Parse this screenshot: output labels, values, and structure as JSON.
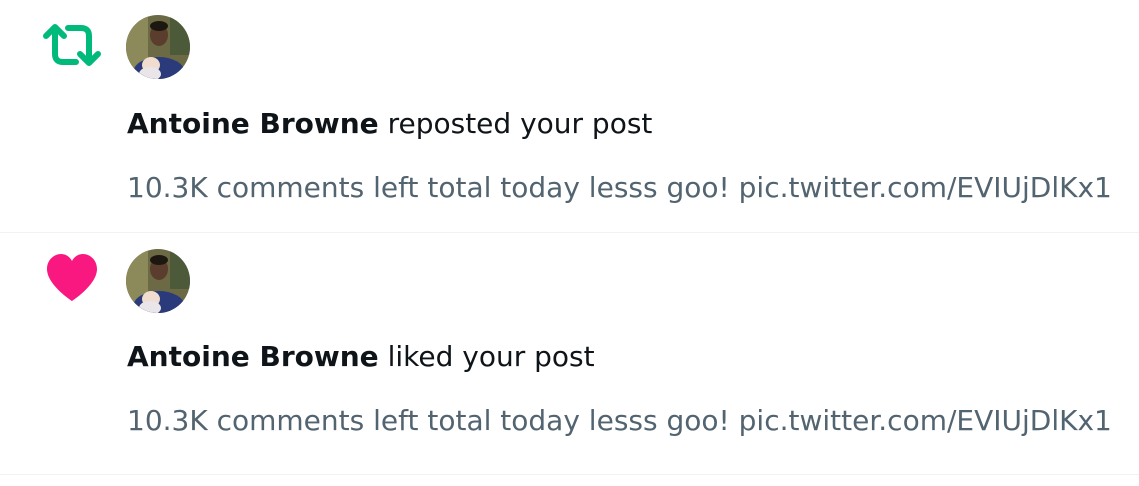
{
  "notifications": [
    {
      "type": "repost",
      "icon": "repost-icon",
      "icon_color": "#00ba7c",
      "user_name": "Antoine Browne",
      "action_text": " reposted your post",
      "post_excerpt": "10.3K comments left total today lesss goo! pic.twitter.com/EVIUjDlKx1"
    },
    {
      "type": "like",
      "icon": "heart-icon",
      "icon_color": "#f91880",
      "user_name": "Antoine Browne",
      "action_text": " liked your post",
      "post_excerpt": "10.3K comments left total today lesss goo! pic.twitter.com/EVIUjDlKx1"
    }
  ],
  "colors": {
    "text_primary": "#0f1419",
    "text_secondary": "#536471",
    "divider": "#eff3f4"
  }
}
